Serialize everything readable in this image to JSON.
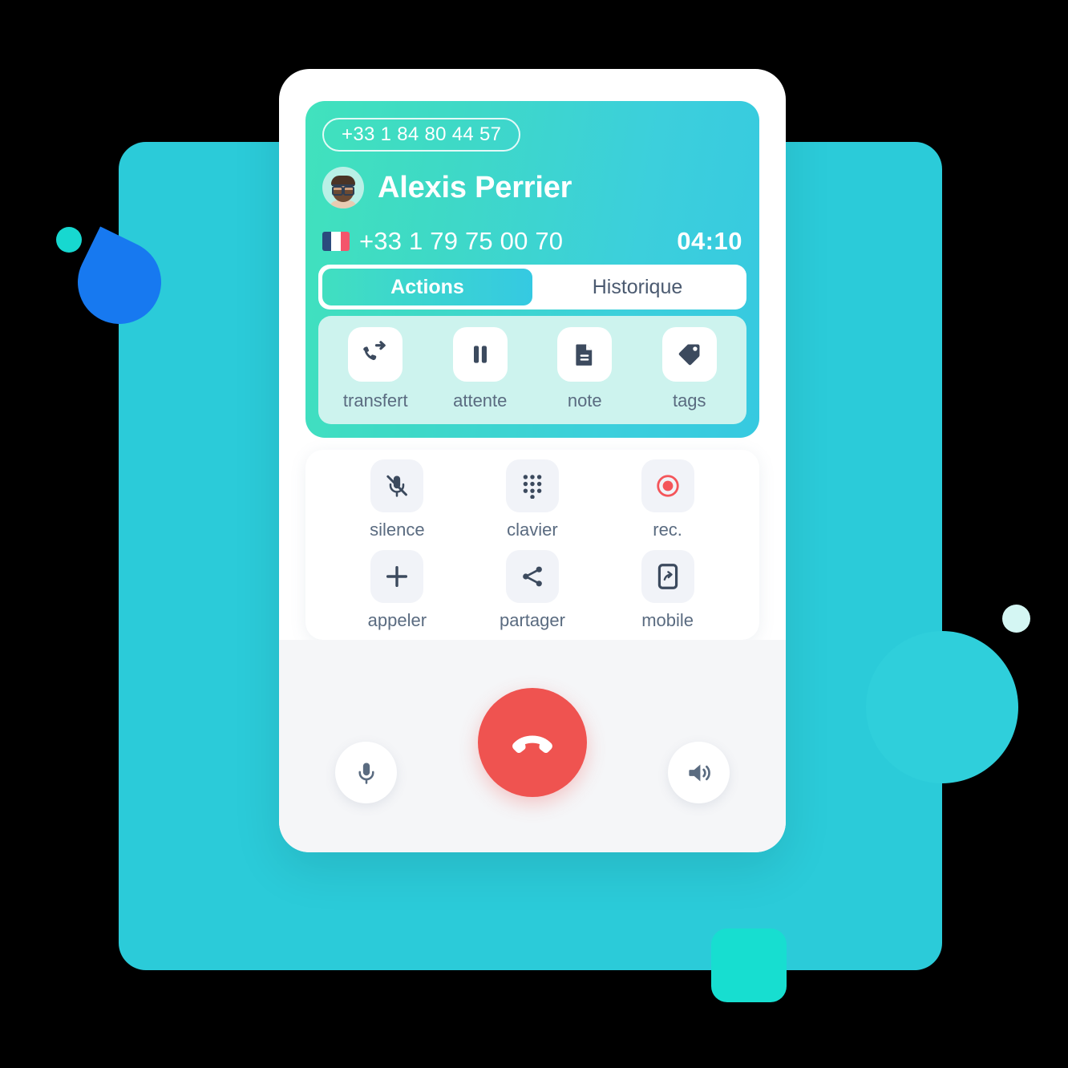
{
  "caller": {
    "did_number": "+33 1 84 80 44 57",
    "name": "Alexis Perrier",
    "phone_number": "+33 1 79 75 00 70",
    "country_flag": "france-flag-icon",
    "avatar": "user-avatar",
    "call_duration": "04:10"
  },
  "tabs": [
    {
      "label": "Actions",
      "active": true
    },
    {
      "label": "Historique",
      "active": false
    }
  ],
  "actions": [
    {
      "label": "transfert",
      "icon": "call-transfer-icon"
    },
    {
      "label": "attente",
      "icon": "pause-icon"
    },
    {
      "label": "note",
      "icon": "document-icon"
    },
    {
      "label": "tags",
      "icon": "tag-icon"
    }
  ],
  "controls": [
    {
      "label": "silence",
      "icon": "microphone-muted-icon"
    },
    {
      "label": "clavier",
      "icon": "dialpad-icon"
    },
    {
      "label": "rec.",
      "icon": "record-icon"
    },
    {
      "label": "appeler",
      "icon": "plus-icon"
    },
    {
      "label": "partager",
      "icon": "share-icon"
    },
    {
      "label": "mobile",
      "icon": "mobile-transfer-icon"
    }
  ],
  "call_bar": {
    "mic_icon": "microphone-icon",
    "hangup_icon": "hangup-phone-icon",
    "speaker_icon": "speaker-icon"
  },
  "colors": {
    "background_panel": "#2bcbd9",
    "header_gradient_start": "#41e2bd",
    "header_gradient_end": "#36c9e0",
    "actions_strip": "#cdf3ee",
    "hangup_red": "#ef5350",
    "record_red": "#f4555a",
    "icon_dark": "#3c4a5e",
    "label_text": "#5a6b80",
    "accent_blue": "#1779f0"
  }
}
